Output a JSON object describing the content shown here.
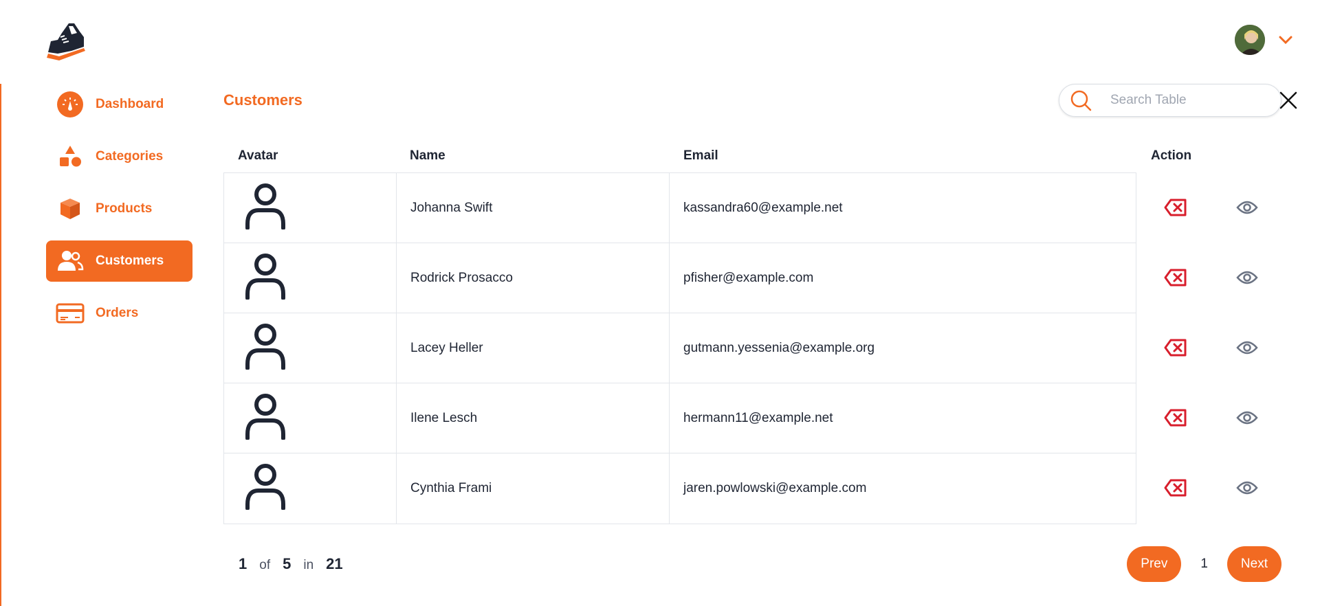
{
  "brand": {
    "logo": "sneaker-logo",
    "accent": "#f26a22"
  },
  "user": {
    "avatar": "user-photo",
    "menu_icon": "chevron-down-icon"
  },
  "sidebar": {
    "items": [
      {
        "label": "Dashboard",
        "icon": "gauge-icon",
        "active": false
      },
      {
        "label": "Categories",
        "icon": "shapes-icon",
        "active": false
      },
      {
        "label": "Products",
        "icon": "box-icon",
        "active": false
      },
      {
        "label": "Customers",
        "icon": "users-icon",
        "active": true
      },
      {
        "label": "Orders",
        "icon": "credit-card-icon",
        "active": false
      }
    ]
  },
  "page": {
    "title": "Customers"
  },
  "search": {
    "placeholder": "Search Table",
    "value": ""
  },
  "table": {
    "columns": {
      "avatar": "Avatar",
      "name": "Name",
      "email": "Email",
      "action": "Action"
    },
    "rows": [
      {
        "name": "Johanna Swift",
        "email": "kassandra60@example.net"
      },
      {
        "name": "Rodrick Prosacco",
        "email": "pfisher@example.com"
      },
      {
        "name": "Lacey Heller",
        "email": "gutmann.yessenia@example.org"
      },
      {
        "name": "Ilene Lesch",
        "email": "hermann11@example.net"
      },
      {
        "name": "Cynthia Frami",
        "email": "jaren.powlowski@example.com"
      }
    ]
  },
  "pagination": {
    "current": "1",
    "of_label": "of",
    "total_pages": "5",
    "in_label": "in",
    "total_items": "21",
    "prev_label": "Prev",
    "page": "1",
    "next_label": "Next"
  }
}
